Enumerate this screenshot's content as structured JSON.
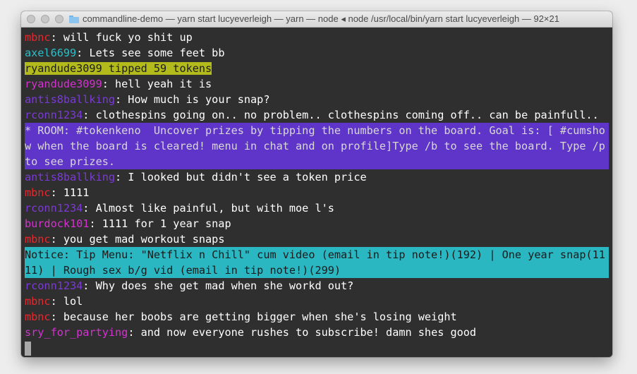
{
  "window": {
    "title": "commandline-demo — yarn start lucyeverleigh — yarn — node ◂ node /usr/local/bin/yarn start lucyeverleigh — 92×21"
  },
  "colors": {
    "red": "#e5292f",
    "teal": "#2bbfc9",
    "magenta": "#d432d0",
    "purple": "#7b3ad6",
    "white": "#ffffff"
  },
  "chat": [
    {
      "user": "mbnc",
      "color": "red",
      "text": ": will fuck yo shit up"
    },
    {
      "user": "axel6699",
      "color": "teal",
      "text": ": Lets see some feet bb"
    },
    {
      "type": "tip",
      "text": "ryandude3099 tipped 59 tokens"
    },
    {
      "user": "ryandude3099",
      "color": "magenta",
      "text": ": hell yeah it is"
    },
    {
      "user": "antis8ballking",
      "color": "purple",
      "text": ": How much is your snap?"
    },
    {
      "user": "rconn1234",
      "color": "purple",
      "text": ": clothespins going on.. no problem.. clothespins coming off.. can be painfull.."
    },
    {
      "type": "room",
      "text": "* ROOM: #tokenkeno  Uncover prizes by tipping the numbers on the board. Goal is: [ #cumshow when the board is cleared! menu in chat and on profile]Type /b to see the board. Type /p to see prizes."
    },
    {
      "user": "antis8ballking",
      "color": "purple",
      "text": ": I looked but didn't see a token price"
    },
    {
      "user": "mbnc",
      "color": "red",
      "text": ": 1111"
    },
    {
      "user": "rconn1234",
      "color": "purple",
      "text": ": Almost like painful, but with moe l's"
    },
    {
      "user": "burdock101",
      "color": "magenta",
      "text": ": 1111 for 1 year snap"
    },
    {
      "user": "mbnc",
      "color": "red",
      "text": ": you get mad workout snaps"
    },
    {
      "type": "notice",
      "text": "Notice: Tip Menu: \"Netflix n Chill\" cum video (email in tip note!)(192) | One year snap(1111) | Rough sex b/g vid (email in tip note!)(299)"
    },
    {
      "user": "rconn1234",
      "color": "purple",
      "text": ": Why does she get mad when she workd out?"
    },
    {
      "user": "mbnc",
      "color": "red",
      "text": ": lol"
    },
    {
      "user": "mbnc",
      "color": "red",
      "text": ": because her boobs are getting bigger when she's losing weight"
    },
    {
      "user": "sry_for_partying",
      "color": "magenta",
      "text": ": and now everyone rushes to subscribe! damn shes good"
    }
  ]
}
